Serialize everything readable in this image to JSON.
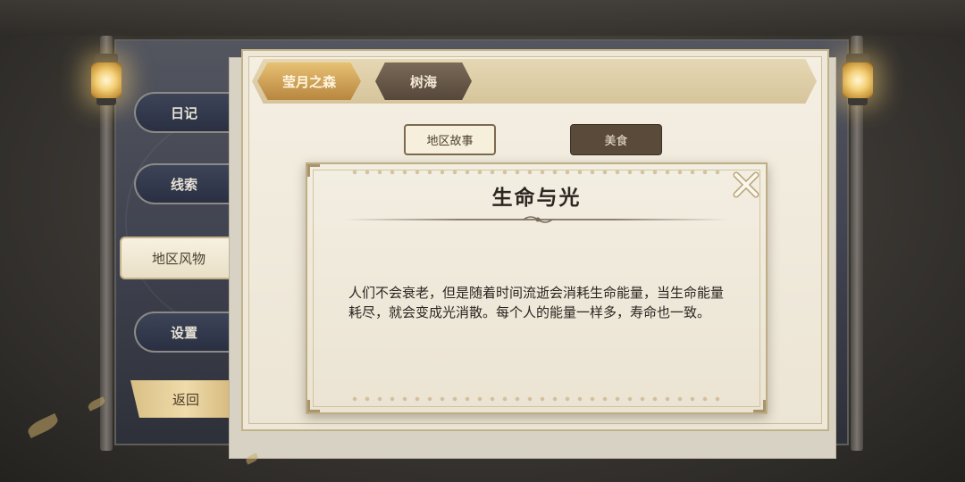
{
  "side_nav": {
    "items": [
      {
        "label": "日记"
      },
      {
        "label": "线索"
      },
      {
        "label": "地区风物"
      },
      {
        "label": "设置"
      }
    ],
    "back_label": "返回"
  },
  "region_tabs": [
    {
      "label": "莹月之森"
    },
    {
      "label": "树海"
    }
  ],
  "category_buttons": [
    {
      "label": "地区故事"
    },
    {
      "label": "美食"
    }
  ],
  "card": {
    "title": "生命与光",
    "body": "人们不会衰老，但是随着时间流逝会消耗生命能量，当生命能量耗尽，就会变成光消散。每个人的能量一样多，寿命也一致。"
  },
  "icons": {
    "close": "close-icon",
    "lamp": "lantern-icon"
  },
  "colors": {
    "active_tab": "#c9974c",
    "inactive_tab": "#5e4f40",
    "parchment": "#f1ebdd"
  }
}
